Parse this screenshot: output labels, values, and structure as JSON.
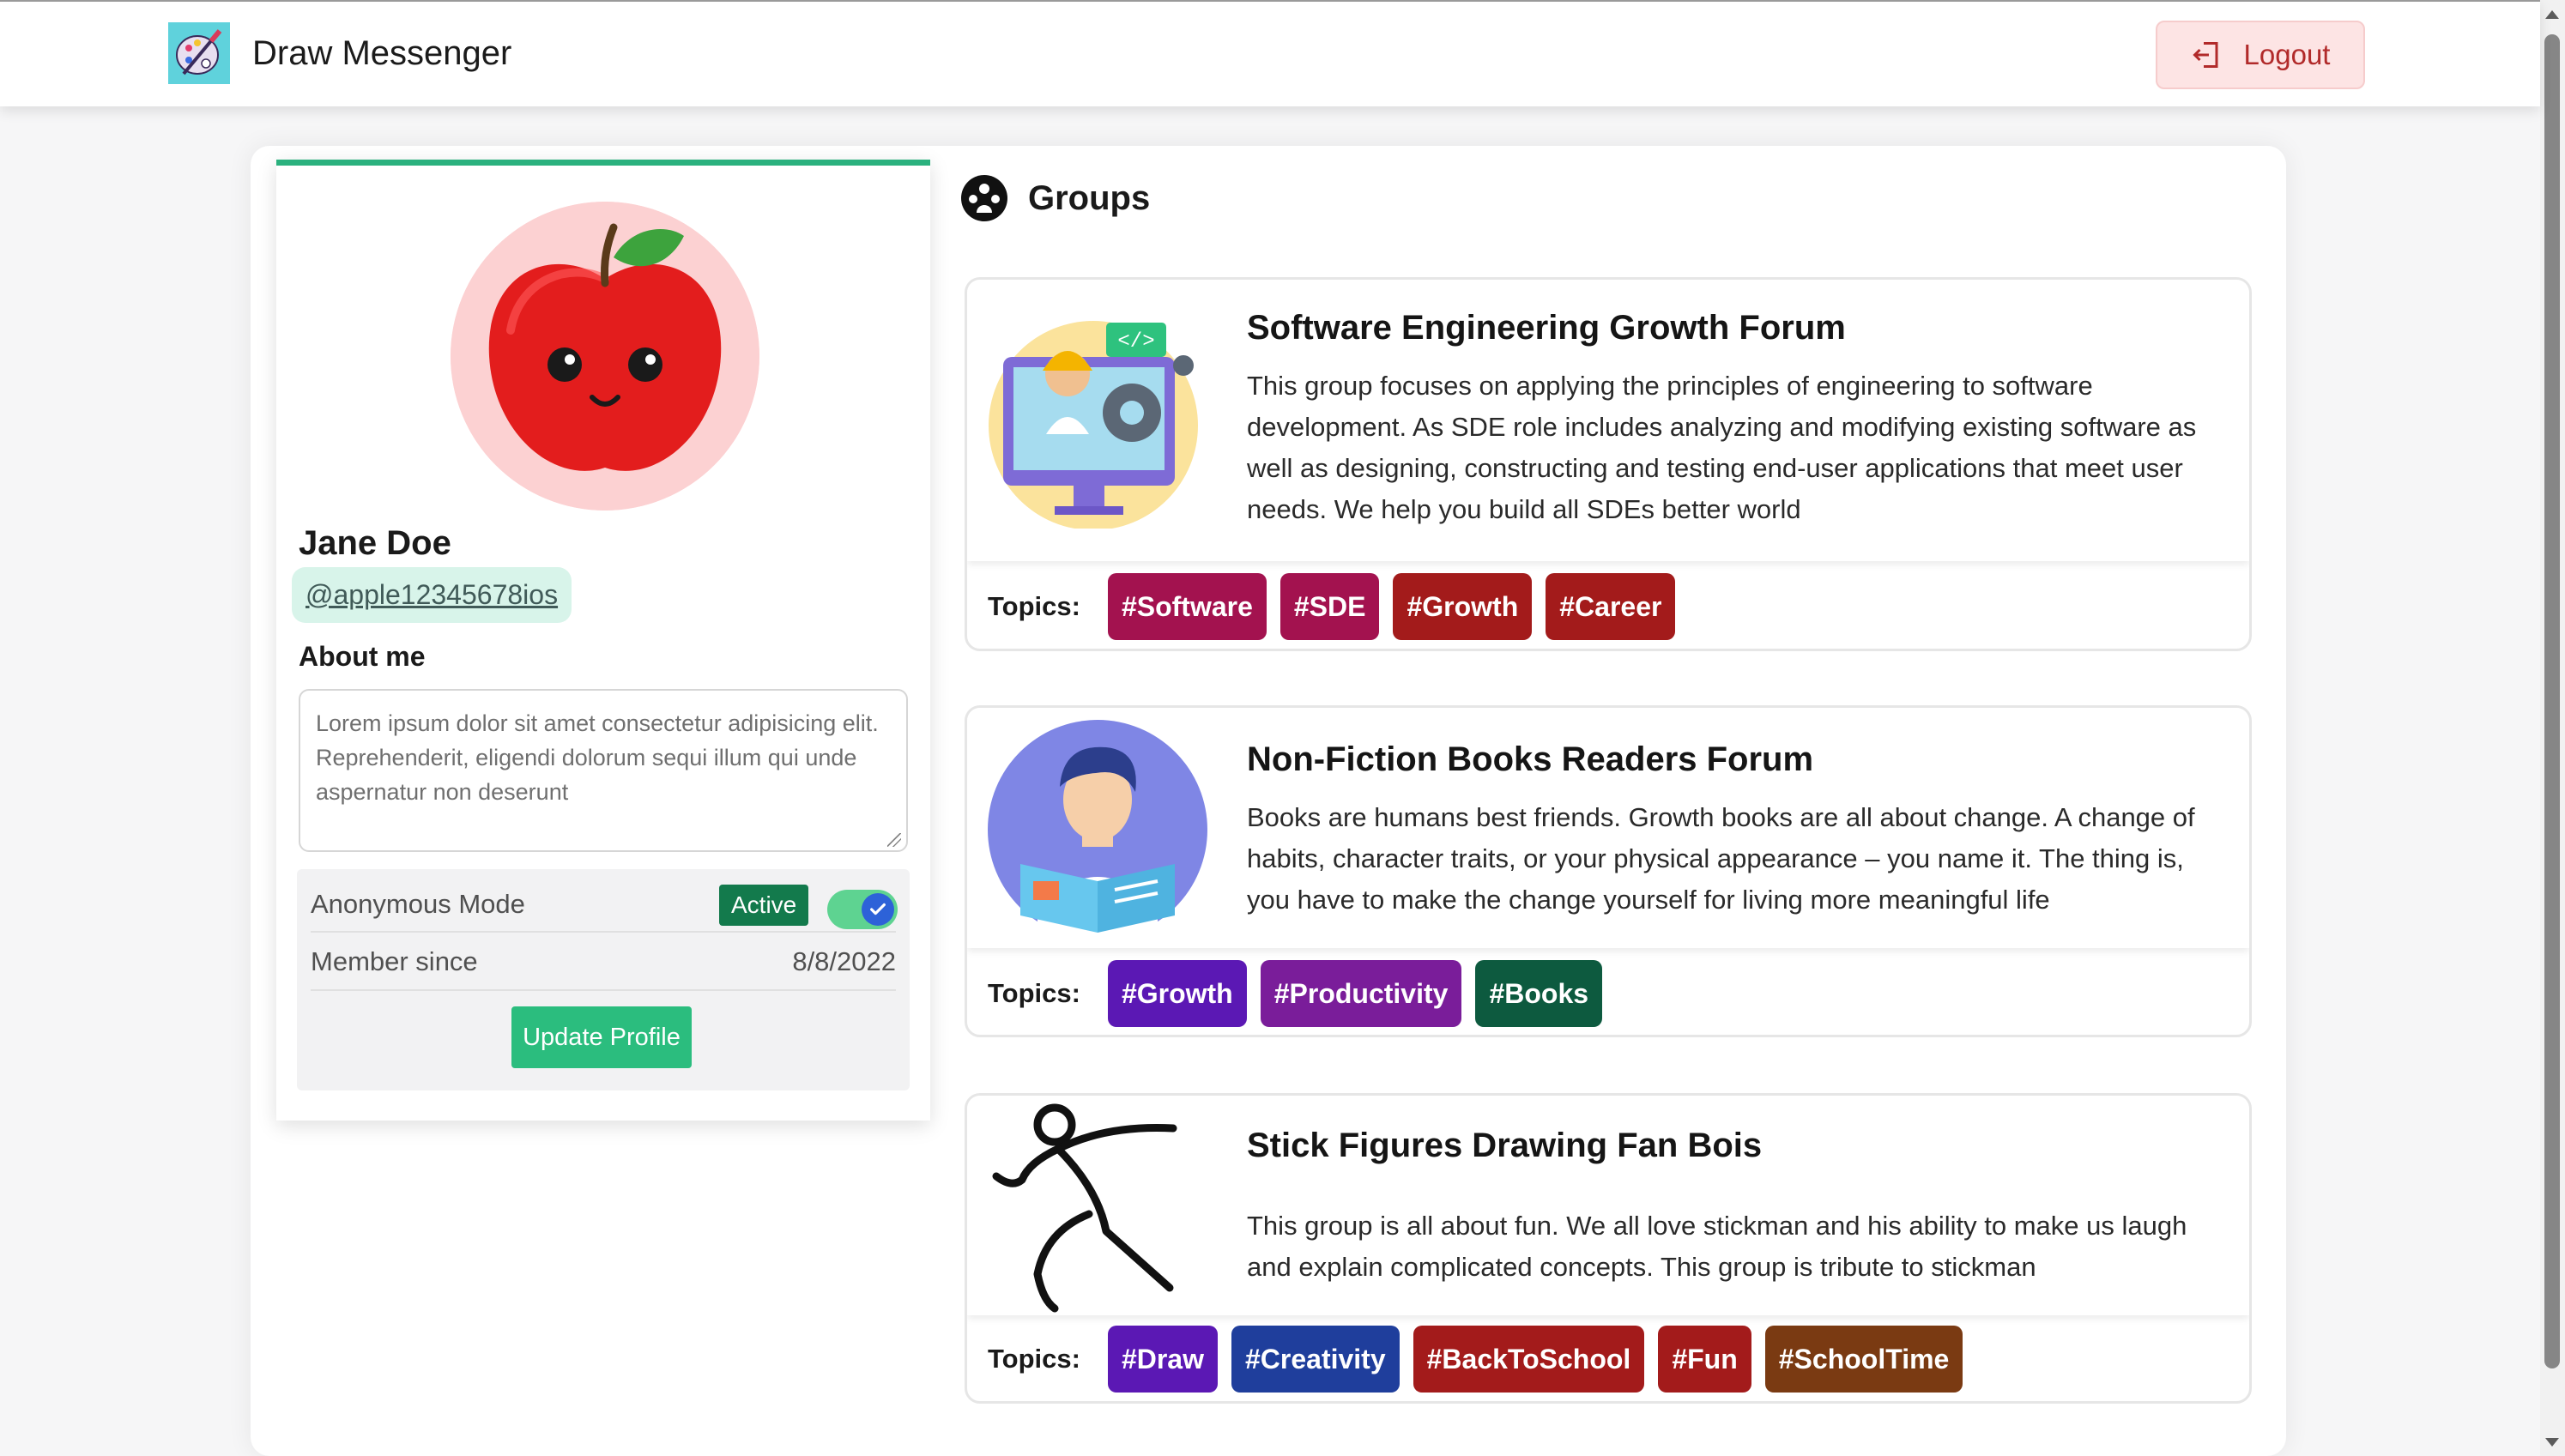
{
  "app": {
    "title": "Draw Messenger",
    "logout_label": "Logout"
  },
  "profile": {
    "name": "Jane Doe",
    "handle": "@apple12345678ios",
    "about_label": "About me",
    "about_text": "Lorem ipsum dolor sit amet consectetur adipisicing elit. Reprehenderit, eligendi dolorum sequi illum qui unde aspernatur non deserunt",
    "anonymous_label": "Anonymous Mode",
    "anonymous_status": "Active",
    "anonymous_enabled": true,
    "member_since_label": "Member since",
    "member_since_value": "8/8/2022",
    "update_button": "Update Profile"
  },
  "groups": {
    "title": "Groups",
    "topics_label": "Topics:",
    "items": [
      {
        "title": "Software Engineering Growth Forum",
        "description": "This group focuses on applying the principles of engineering to software development. As SDE role includes analyzing and modifying existing software as well as designing, constructing and testing end-user applications that meet user needs. We help you build all SDEs better world",
        "image": "software-engineer-icon",
        "tags": [
          {
            "label": "#Software",
            "color": "#a3124f"
          },
          {
            "label": "#SDE",
            "color": "#a3124f"
          },
          {
            "label": "#Growth",
            "color": "#a31b1b"
          },
          {
            "label": "#Career",
            "color": "#a31b1b"
          }
        ]
      },
      {
        "title": "Non-Fiction Books Readers Forum",
        "description": "Books are humans best friends. Growth books are all about change. A change of habits, character traits, or your physical appearance – you name it. The thing is, you have to make the change yourself for living more meaningful life",
        "image": "book-reader-icon",
        "tags": [
          {
            "label": "#Growth",
            "color": "#5b18b4"
          },
          {
            "label": "#Productivity",
            "color": "#7a1d9a"
          },
          {
            "label": "#Books",
            "color": "#0d5a3f"
          }
        ]
      },
      {
        "title": "Stick Figures Drawing Fan Bois",
        "description": "This group is all about fun. We all love stickman and his ability to make us laugh and explain complicated concepts. This group is tribute to stickman",
        "image": "stick-figure-icon",
        "tags": [
          {
            "label": "#Draw",
            "color": "#5b18b4"
          },
          {
            "label": "#Creativity",
            "color": "#1f3e9c"
          },
          {
            "label": "#BackToSchool",
            "color": "#a31b1b"
          },
          {
            "label": "#Fun",
            "color": "#a31b1b"
          },
          {
            "label": "#SchoolTime",
            "color": "#7a3a12"
          }
        ]
      }
    ]
  },
  "colors": {
    "accent": "#2bbd7e",
    "logout_bg": "#fde4e4",
    "logout_text": "#b12a2a"
  }
}
